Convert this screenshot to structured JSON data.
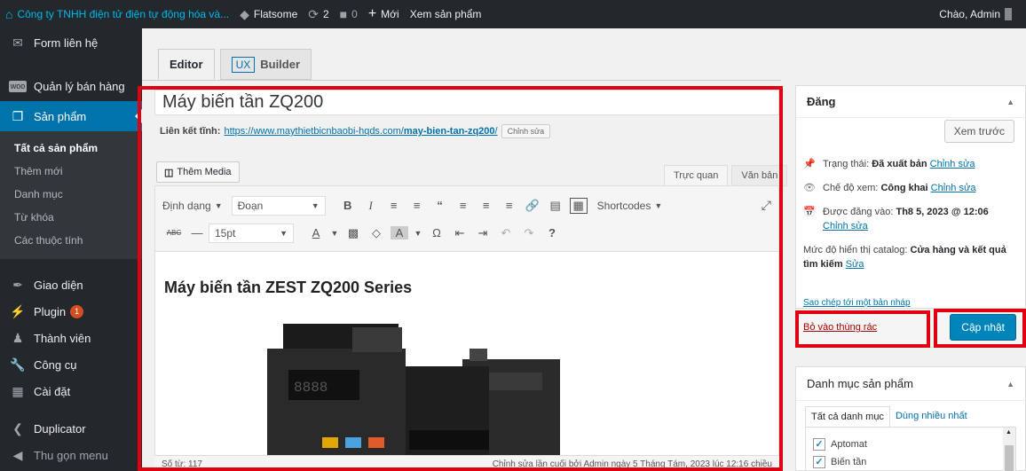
{
  "adminbar": {
    "site_name": "Công ty TNHH điện tử điện tự động hóa và...",
    "flatsome": "Flatsome",
    "updates_count": "2",
    "comments_count": "0",
    "new_label": "Mới",
    "view_product": "Xem sản phẩm",
    "greeting": "Chào, Admin"
  },
  "sidebar": {
    "items_top": [
      {
        "label": "Form liên hệ",
        "icon": "mail-icon"
      },
      {
        "label": "Quản lý bán hàng",
        "icon": "woo-icon"
      },
      {
        "label": "Sản phẩm",
        "icon": "product-box-icon"
      }
    ],
    "submenu": [
      "Tất cả sản phẩm",
      "Thêm mới",
      "Danh mục",
      "Từ khóa",
      "Các thuộc tính"
    ],
    "items_bottom": [
      {
        "label": "Giao diện",
        "icon": "brush-icon"
      },
      {
        "label": "Plugin",
        "icon": "plugin-icon",
        "badge": "1"
      },
      {
        "label": "Thành viên",
        "icon": "user-icon"
      },
      {
        "label": "Công cụ",
        "icon": "wrench-icon"
      },
      {
        "label": "Cài đặt",
        "icon": "settings-icon"
      },
      {
        "label": "Duplicator",
        "icon": "share-icon"
      },
      {
        "label": "Thu gọn menu",
        "icon": "collapse-icon"
      }
    ]
  },
  "tabs": {
    "editor": "Editor",
    "ux": "UX",
    "builder": "Builder"
  },
  "post": {
    "title": "Máy biến tần ZQ200",
    "permalink_label": "Liên kết tĩnh:",
    "permalink_base": "https://www.maythietbicnbaobi-hqds.com/",
    "permalink_slug": "may-bien-tan-zq200",
    "permalink_end": "/",
    "edit_label": "Chỉnh sửa"
  },
  "editor": {
    "add_media": "Thêm Media",
    "visual_tab": "Trực quan",
    "text_tab": "Văn bản",
    "format_label": "Định dạng",
    "paragraph": "Đoạn",
    "font_size": "15pt",
    "shortcodes": "Shortcodes",
    "heading": "Máy biến tần ZEST ZQ200 Series",
    "word_count": "Số từ: 117",
    "last_edited": "Chỉnh sửa lần cuối bởi Admin ngày 5 Tháng Tám, 2023 lúc 12:16 chiều",
    "device_display": "8888"
  },
  "publish": {
    "title": "Đăng",
    "preview": "Xem trước",
    "status_label": "Trạng thái:",
    "status_value": "Đã xuất bản",
    "status_edit": "Chỉnh sửa",
    "visibility_label": "Chế độ xem:",
    "visibility_value": "Công khai",
    "visibility_edit": "Chỉnh sửa",
    "date_label": "Được đăng vào:",
    "date_value": "Th8 5, 2023 @ 12:06",
    "date_edit": "Chỉnh sửa",
    "catalog_label": "Mức độ hiển thị catalog:",
    "catalog_value": "Cửa hàng và kết quả tìm kiếm",
    "catalog_edit": "Sửa",
    "copy_draft": "Sao chép tới một bản nháp",
    "trash": "Bỏ vào thùng rác",
    "update": "Cập nhật"
  },
  "categories": {
    "title": "Danh mục sản phẩm",
    "tab_all": "Tất cả danh mục",
    "tab_popular": "Dùng nhiều nhất",
    "items": [
      {
        "label": "Aptomat",
        "checked": true
      },
      {
        "label": "Biến tần",
        "checked": true
      }
    ]
  },
  "colors": {
    "accent": "#0073aa",
    "highlight": "#e0000f",
    "adminbar": "#23282d"
  }
}
